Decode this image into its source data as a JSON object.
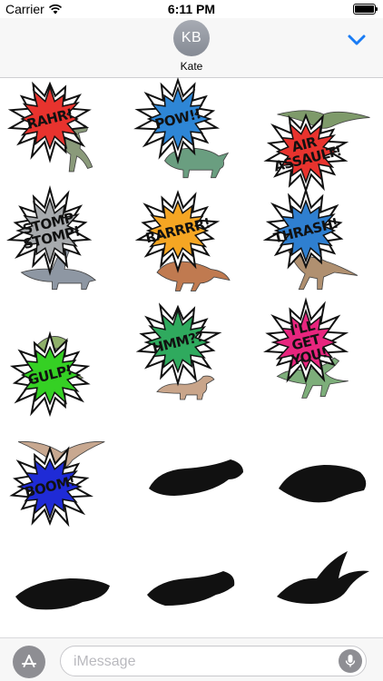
{
  "status_bar": {
    "carrier": "Carrier",
    "time": "6:11 PM",
    "battery_level": 1.0
  },
  "header": {
    "avatar_initials": "KB",
    "contact_name": "Kate"
  },
  "stickers": [
    {
      "text": "RAHR!",
      "burst_color": "#e8332e",
      "dino": "t-rex"
    },
    {
      "text": "POW!!",
      "burst_color": "#2e86d6",
      "dino": "triceratops"
    },
    {
      "text": "AIR ASSAULT!",
      "burst_color": "#e8332e",
      "dino": "pteranodon"
    },
    {
      "text": "STOMP STOMP!",
      "burst_color": "#a7aaad",
      "dino": "sauropod"
    },
    {
      "text": "RARRRR!",
      "burst_color": "#f5a623",
      "dino": "dilophosaurus"
    },
    {
      "text": "THRASH!",
      "burst_color": "#2f7fd0",
      "dino": "velociraptor"
    },
    {
      "text": "GULP!",
      "burst_color": "#35d024",
      "dino": "dilophosaurus-frill"
    },
    {
      "text": "HMM??",
      "burst_color": "#2faa5e",
      "dino": "hadrosaur"
    },
    {
      "text": "I'LL GET YOU!",
      "burst_color": "#e8257e",
      "dino": "compsognathus"
    },
    {
      "text": "BOOM!",
      "burst_color": "#1f2bd6",
      "dino": "pterosaur"
    },
    {
      "text": "",
      "dino": "skull-1"
    },
    {
      "text": "",
      "dino": "skull-2"
    },
    {
      "text": "",
      "dino": "skull-3"
    },
    {
      "text": "",
      "dino": "skull-4"
    },
    {
      "text": "",
      "dino": "skull-5"
    }
  ],
  "input_bar": {
    "placeholder": "iMessage",
    "apps_icon": "app-store-icon",
    "mic_icon": "microphone-icon"
  },
  "colors": {
    "accent": "#1a7cf5",
    "header_bg": "#f7f7f7",
    "avatar_bg": "#9a9ea6"
  }
}
